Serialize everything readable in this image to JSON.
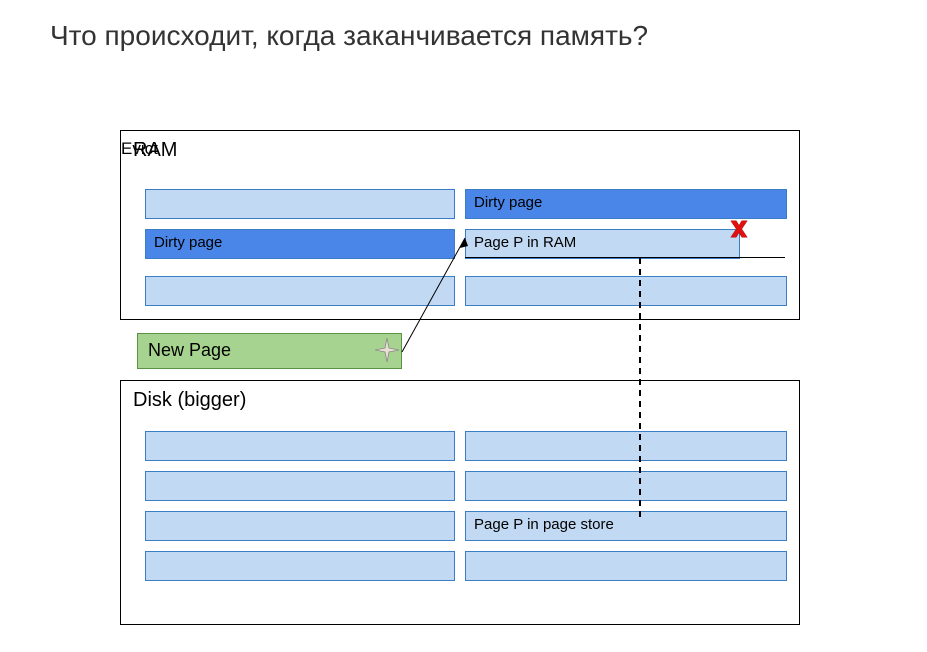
{
  "title": "Что происходит, когда заканчивается память?",
  "ram": {
    "label": "RAM",
    "pages": {
      "p2_dirty": "Dirty page",
      "p3_dirty": "Dirty page",
      "p4": "Page P in RAM",
      "evict": "Evict"
    }
  },
  "newpage": {
    "label": "New Page"
  },
  "disk": {
    "label": "Disk (bigger)",
    "pages": {
      "p6": "Page P in page store"
    }
  }
}
